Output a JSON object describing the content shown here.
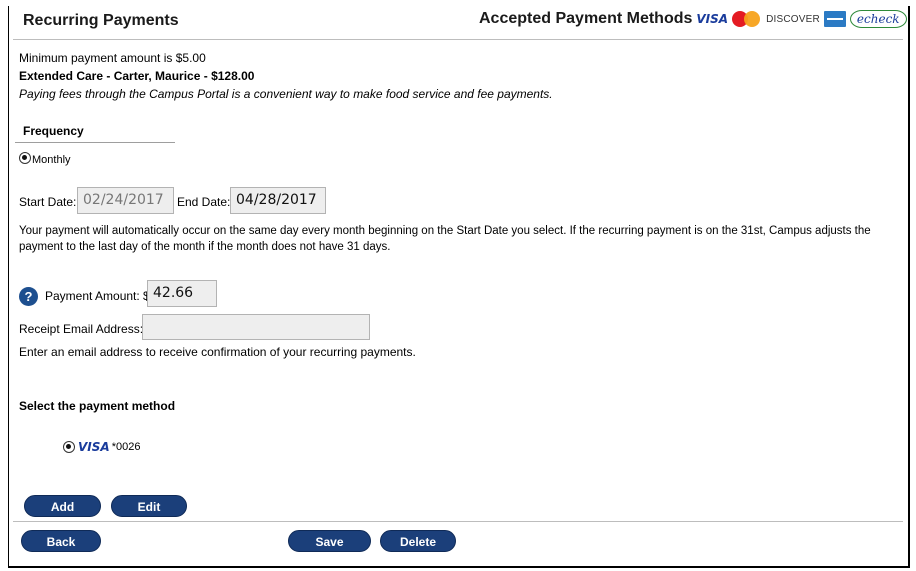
{
  "header": {
    "title": "Recurring Payments",
    "methods_label": "Accepted Payment Methods",
    "logos": {
      "visa": "VISA",
      "mastercard_icon": "mastercard-icon",
      "discover": "DISCOVER",
      "amex_icon": "amex-icon",
      "echeck": "echeck"
    }
  },
  "info": {
    "minimum": "Minimum payment amount is $5.00",
    "item": "Extended Care - Carter, Maurice - $128.00",
    "note": "Paying fees through the Campus Portal is a convenient way to make food service and fee payments."
  },
  "frequency": {
    "heading": "Frequency",
    "option": "Monthly"
  },
  "dates": {
    "start_label": "Start Date:",
    "start_value": "02/24/2017",
    "end_label": "End Date:",
    "end_value": "04/28/2017"
  },
  "schedule_note_line1": "Your payment will automatically occur on the same day every month beginning on the Start Date you select. If the recurring payment is on the 31st, Campus adjusts the",
  "schedule_note_line2": "payment to the last day of the month if the month does not have 31 days.",
  "payment": {
    "help_icon": "?",
    "amount_label": "Payment Amount: $",
    "amount_value": "42.66"
  },
  "email": {
    "label": "Receipt Email Address:",
    "value": "",
    "hint": "Enter an email address to receive confirmation of your recurring payments."
  },
  "method": {
    "heading": "Select the payment method",
    "card_brand": "VISA",
    "card_suffix": "*0026"
  },
  "buttons": {
    "add": "Add",
    "edit": "Edit",
    "back": "Back",
    "save": "Save",
    "delete": "Delete"
  },
  "colors": {
    "button": "#1b3f7a",
    "help": "#1d4f8f"
  }
}
